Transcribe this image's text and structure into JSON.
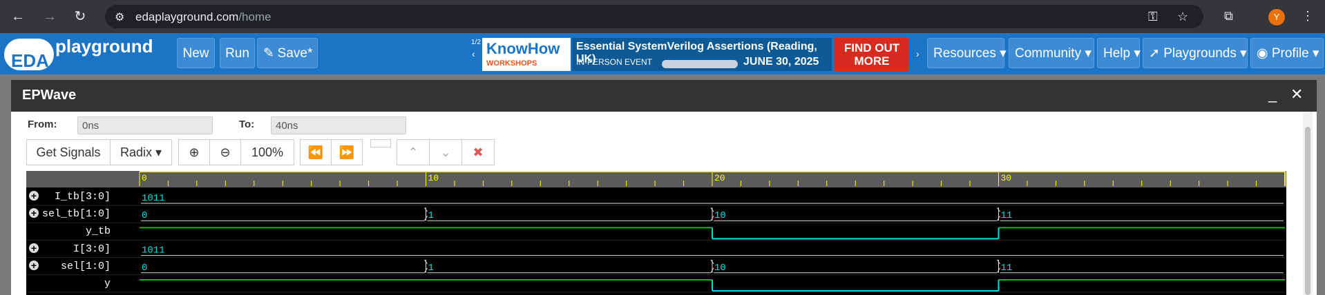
{
  "browser": {
    "url_host": "edaplayground.com",
    "url_path": "/home",
    "avatar_initial": "Y"
  },
  "navbar": {
    "logo_eda": "EDA",
    "logo_playground": "playground",
    "buttons": [
      "New",
      "Run",
      "Save*"
    ],
    "right_menu": [
      "Resources",
      "Community",
      "Help",
      "Playgrounds",
      "Profile"
    ]
  },
  "ad": {
    "pager": "1/2",
    "brand": "KnowHow",
    "brand_sub": "WORKSHOPS",
    "headline": "Essential SystemVerilog Assertions (Reading, UK)",
    "event": "IN-PERSON EVENT",
    "date": "JUNE 30, 2025",
    "cta": "FIND OUT MORE"
  },
  "epwave": {
    "title": "EPWave",
    "from_label": "From:",
    "from_value": "0ns",
    "to_label": "To:",
    "to_value": "40ns",
    "toolbar": {
      "get_signals": "Get Signals",
      "radix": "Radix",
      "zoom": "100%"
    },
    "ruler_labels": [
      "0",
      "10",
      "20",
      "30"
    ],
    "signals": [
      {
        "name": "I_tb[3:0]",
        "expandable": true,
        "type": "bus",
        "segments": [
          {
            "t0": 0,
            "t1": 40,
            "value": "1011"
          }
        ]
      },
      {
        "name": "sel_tb[1:0]",
        "expandable": true,
        "type": "bus",
        "segments": [
          {
            "t0": 0,
            "t1": 10,
            "value": "0"
          },
          {
            "t0": 10,
            "t1": 20,
            "value": "1"
          },
          {
            "t0": 20,
            "t1": 30,
            "value": "10"
          },
          {
            "t0": 30,
            "t1": 40,
            "value": "11"
          }
        ]
      },
      {
        "name": "y_tb",
        "expandable": false,
        "type": "bit",
        "levels": [
          {
            "t0": 0,
            "t1": 20,
            "v": 1
          },
          {
            "t0": 20,
            "t1": 30,
            "v": 0
          },
          {
            "t0": 30,
            "t1": 40,
            "v": 1
          }
        ]
      },
      {
        "name": "I[3:0]",
        "expandable": true,
        "type": "bus",
        "segments": [
          {
            "t0": 0,
            "t1": 40,
            "value": "1011"
          }
        ]
      },
      {
        "name": "sel[1:0]",
        "expandable": true,
        "type": "bus",
        "segments": [
          {
            "t0": 0,
            "t1": 10,
            "value": "0"
          },
          {
            "t0": 10,
            "t1": 20,
            "value": "1"
          },
          {
            "t0": 20,
            "t1": 30,
            "value": "10"
          },
          {
            "t0": 30,
            "t1": 40,
            "value": "11"
          }
        ]
      },
      {
        "name": "y",
        "expandable": false,
        "type": "bit",
        "levels": [
          {
            "t0": 0,
            "t1": 20,
            "v": 1
          },
          {
            "t0": 20,
            "t1": 30,
            "v": 0
          },
          {
            "t0": 30,
            "t1": 40,
            "v": 1
          }
        ]
      }
    ],
    "colors": {
      "ruler_text": "#ffff00",
      "bus": "#00e0e0",
      "bit_high": "#00c000",
      "bit_low": "#00e0e0"
    }
  }
}
